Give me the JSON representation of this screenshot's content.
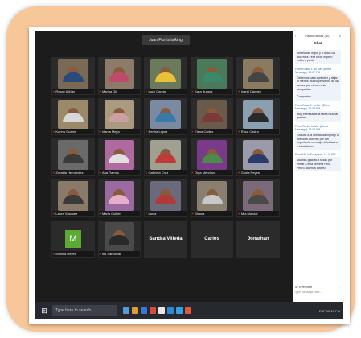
{
  "meeting": {
    "banner": "Juan Flor is talking",
    "tiles": [
      {
        "name": "Rosay Adrián",
        "kind": "video",
        "bg": "#7a6a55",
        "shirt": "#2a4a7a"
      },
      {
        "name": "Marina Gil",
        "kind": "video",
        "bg": "#8c7b68",
        "shirt": "#c04a6a"
      },
      {
        "name": "Lucy Garcia",
        "kind": "video",
        "bg": "#6b7a5a",
        "shirt": "#e8c03a"
      },
      {
        "name": "Sara Burgos",
        "kind": "video",
        "bg": "#4a7a5a",
        "shirt": "#3a8a6a"
      },
      {
        "name": "Ingrid Carmen",
        "kind": "video",
        "bg": "#8a7a60",
        "shirt": "#444444"
      },
      {
        "name": "Karina Guerra",
        "kind": "video",
        "bg": "#9a8a6a",
        "shirt": "#d8d8d8"
      },
      {
        "name": "Idania Mejía",
        "kind": "video",
        "bg": "#aa9a80",
        "shirt": "#caa0a0"
      },
      {
        "name": "Bertha López",
        "kind": "video",
        "bg": "#7a8aa0",
        "shirt": "#3a7aa8"
      },
      {
        "name": "Elena Cortés",
        "kind": "video",
        "bg": "#6a5a4a",
        "shirt": "#7a3a3a"
      },
      {
        "name": "Rosa Castro",
        "kind": "video",
        "bg": "#8aa0b0",
        "shirt": "#2a2a2a"
      },
      {
        "name": "Zoraida Hernández",
        "kind": "video",
        "bg": "#6a6a6a",
        "shirt": "#3a3a3a"
      },
      {
        "name": "Ana Ramos",
        "kind": "video",
        "bg": "#b06aa0",
        "shirt": "#e0e0e0"
      },
      {
        "name": "Gabriela Cruz",
        "kind": "video",
        "bg": "#a0a090",
        "shirt": "#c03a3a"
      },
      {
        "name": "Olga Mendoza",
        "kind": "video",
        "bg": "#7a3a8a",
        "shirt": "#4a8a4a"
      },
      {
        "name": "Gloria Reyes",
        "kind": "video",
        "bg": "#9a9aaa",
        "shirt": "#2a3a6a"
      },
      {
        "name": "Laura Vásquez",
        "kind": "video",
        "bg": "#8a7a6a",
        "shirt": "#3a3a3a"
      },
      {
        "name": "Maria Guillén",
        "kind": "video",
        "bg": "#9a6aa0",
        "shirt": "#e8b0c8"
      },
      {
        "name": "Lucía",
        "kind": "video",
        "bg": "#6a6a7a",
        "shirt": "#b03a3a"
      },
      {
        "name": "Blanca",
        "kind": "video",
        "bg": "#8a8070",
        "shirt": "#c8c8c8"
      },
      {
        "name": "Mía Marcial",
        "kind": "video",
        "bg": "#7a6a7a",
        "shirt": "#4a4a4a"
      },
      {
        "name": "Mónica Reyes",
        "kind": "initial",
        "initial": "M"
      },
      {
        "name": "Iris Sandoval",
        "kind": "video",
        "bg": "#4a4a4a",
        "shirt": "#2a2a2a"
      },
      {
        "name": "Sandra Villeda",
        "kind": "name"
      },
      {
        "name": "Carlos",
        "kind": "name"
      },
      {
        "name": "Jonathan",
        "kind": "name"
      }
    ]
  },
  "panel": {
    "top_label": "Participantes (30)",
    "title": "Chat",
    "messages": [
      {
        "from": "",
        "text": "profesoras Ingrid y a todos los docentes Feliz tarde espero estén a punto"
      },
      {
        "from": "From Rosita L. to Me: (Direct Message) 12:07 PM",
        "text": "Debemos para aprender y dejar lo menos mucho provecho de las tareas que vienen a las compañías"
      },
      {
        "from": "",
        "text": "Compartan"
      },
      {
        "from": "From Rosa D. to Me: (Direct Message) 12:08 PM",
        "text": "muy interesante la tarea muchas gracias"
      },
      {
        "from": "From Carlos to Me: (Direct Message) 12:09 PM",
        "text": "Gracias a la licenciada Ingrid y al personal docente por tan importante mensaje, felicidades y bendiciones"
      },
      {
        "from": "From Mi. to Everyone: 12:10 PM",
        "text": "Muchas gracias a todas por entrar a esta Tercera Feria Pedro. Buenas tardes!"
      }
    ],
    "compose_to": "To: Everyone",
    "compose_placeholder": "Type message here..."
  },
  "taskbar": {
    "search_placeholder": "Type here to search",
    "tray_text": "ESP 12:10 PM",
    "icon_colors": [
      "#5a9ad8",
      "#e0a030",
      "#3a78d8",
      "#d84a3a",
      "#e8e8e8",
      "#2a8ad8",
      "#38a0e0",
      "#e05a3a"
    ]
  }
}
